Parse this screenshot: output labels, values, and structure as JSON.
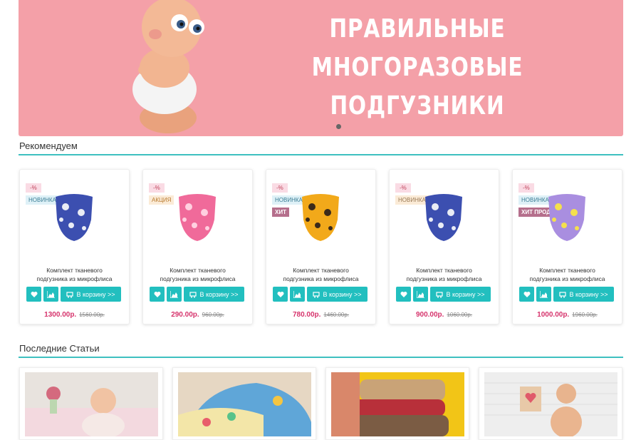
{
  "banner": {
    "lines": [
      "ПРАВИЛЬНЫЕ",
      "МНОГОРАЗОВЫЕ",
      "ПОДГУЗНИКИ"
    ],
    "bg_color": "#f4a0a8"
  },
  "recommend": {
    "title": "Рекомендуем",
    "cards": [
      {
        "pct": "-%",
        "badge": "НОВИНКА",
        "badge2": "",
        "name_line1": "Комплект тканевого",
        "name_line2": "подгузника из микрофлиса",
        "price": "1300.00р.",
        "old_price": "1560.00р.",
        "cart_label": "В корзину >>"
      },
      {
        "pct": "-%",
        "badge": "АКЦИЯ",
        "badge2": "",
        "name_line1": "Комплект тканевого",
        "name_line2": "подгузника из микрофлиса",
        "price": "290.00р.",
        "old_price": "960.00р.",
        "cart_label": "В корзину >>"
      },
      {
        "pct": "-%",
        "badge": "НОВИНКА",
        "badge2": "ХИТ",
        "name_line1": "Комплект тканевого",
        "name_line2": "подгузника из микрофлиса",
        "price": "780.00р.",
        "old_price": "1460.00р.",
        "cart_label": "В корзину >>"
      },
      {
        "pct": "-%",
        "badge": "НОВИНКА",
        "badge2": "",
        "name_line1": "Комплект тканевого",
        "name_line2": "подгузника из микрофлиса",
        "price": "900.00р.",
        "old_price": "1060.00р.",
        "cart_label": "В корзину >>"
      },
      {
        "pct": "-%",
        "badge": "НОВИНКА",
        "badge2": "ХИТ ПРОДАЖ",
        "name_line1": "Комплект тканевого",
        "name_line2": "подгузника из микрофлиса",
        "price": "1000.00р.",
        "old_price": "1960.00р.",
        "cart_label": "В корзину >>"
      }
    ]
  },
  "articles": {
    "title": "Последние Статьи"
  },
  "colors": {
    "accent": "#22bfbf",
    "price": "#d6336c",
    "divider": "#3ec0c0"
  }
}
